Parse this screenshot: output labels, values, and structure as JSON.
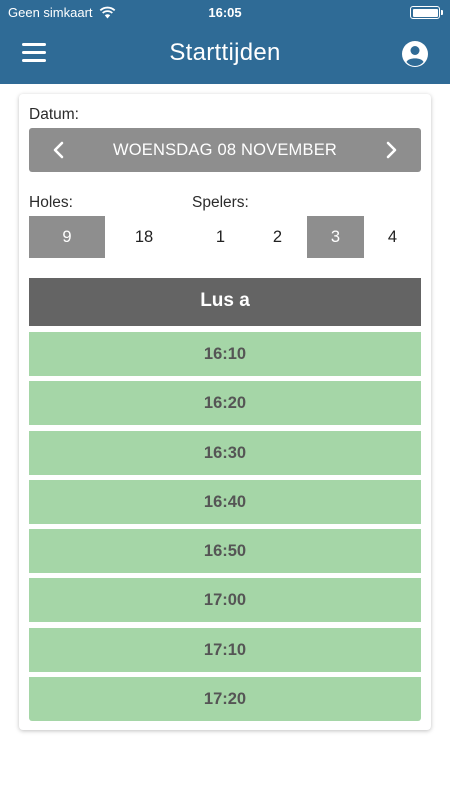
{
  "status_bar": {
    "carrier": "Geen simkaart",
    "time": "16:05",
    "wifi_icon": "wifi-icon",
    "battery_level": 1.0
  },
  "header": {
    "title": "Starttijden",
    "menu_icon": "hamburger-menu-icon",
    "account_icon": "account-circle-icon"
  },
  "colors": {
    "header_bg": "#2f6b96",
    "selector_bg": "#8e8e8e",
    "lus_bg": "#646464",
    "slot_bg": "#a5d6a7"
  },
  "date": {
    "label": "Datum:",
    "value": "WOENSDAG 08 NOVEMBER"
  },
  "holes": {
    "label": "Holes:",
    "options": [
      "9",
      "18"
    ],
    "selected": "9"
  },
  "players": {
    "label": "Spelers:",
    "options": [
      "1",
      "2",
      "3",
      "4"
    ],
    "selected": "3"
  },
  "loop": {
    "title": "Lus a"
  },
  "slots": [
    "16:10",
    "16:20",
    "16:30",
    "16:40",
    "16:50",
    "17:00",
    "17:10",
    "17:20"
  ]
}
